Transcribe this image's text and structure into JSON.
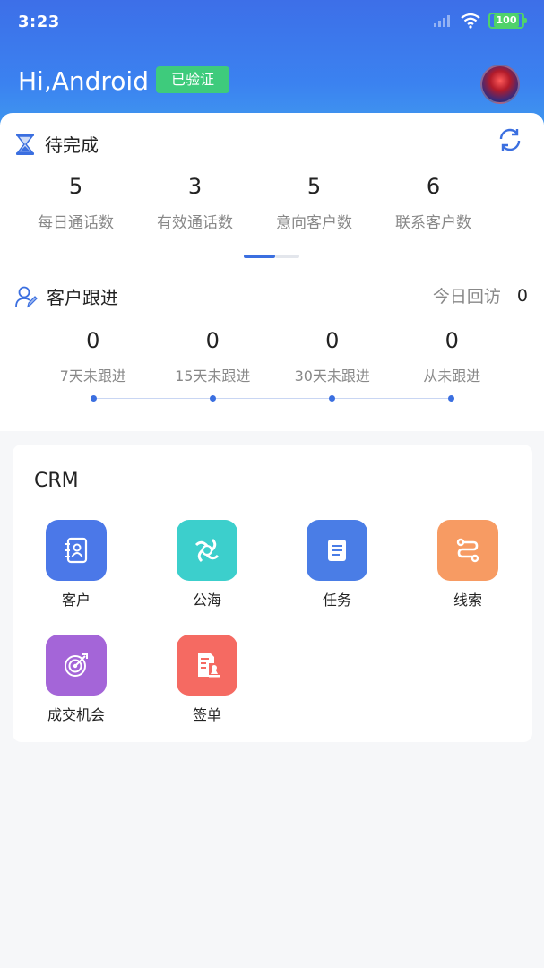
{
  "status_bar": {
    "time": "3:23",
    "battery": "100"
  },
  "header": {
    "greeting": "Hi,Android",
    "badge": "已验证"
  },
  "todo": {
    "title": "待完成",
    "stats": [
      {
        "value": "5",
        "label": "每日通话数"
      },
      {
        "value": "3",
        "label": "有效通话数"
      },
      {
        "value": "5",
        "label": "意向客户数"
      },
      {
        "value": "6",
        "label": "联系客户数"
      }
    ]
  },
  "followup": {
    "title": "客户跟进",
    "today_label": "今日回访",
    "today_count": "0",
    "items": [
      {
        "value": "0",
        "label": "7天未跟进"
      },
      {
        "value": "0",
        "label": "15天未跟进"
      },
      {
        "value": "0",
        "label": "30天未跟进"
      },
      {
        "value": "0",
        "label": "从未跟进"
      }
    ]
  },
  "crm": {
    "title": "CRM",
    "tiles": [
      {
        "label": "客户",
        "icon": "contacts-book-icon",
        "color": "#4b78e8"
      },
      {
        "label": "公海",
        "icon": "swirl-icon",
        "color": "#3ccfcc"
      },
      {
        "label": "任务",
        "icon": "task-list-icon",
        "color": "#4a7de6"
      },
      {
        "label": "线索",
        "icon": "route-icon",
        "color": "#f79b63"
      },
      {
        "label": "成交机会",
        "icon": "target-icon",
        "color": "#a465d8"
      },
      {
        "label": "签单",
        "icon": "contract-stamp-icon",
        "color": "#f56a62"
      }
    ]
  },
  "colors": {
    "accent": "#3b6fe0",
    "header_start": "#3d6fe8",
    "header_end": "#42a4ee",
    "verified": "#3ecb7c"
  }
}
